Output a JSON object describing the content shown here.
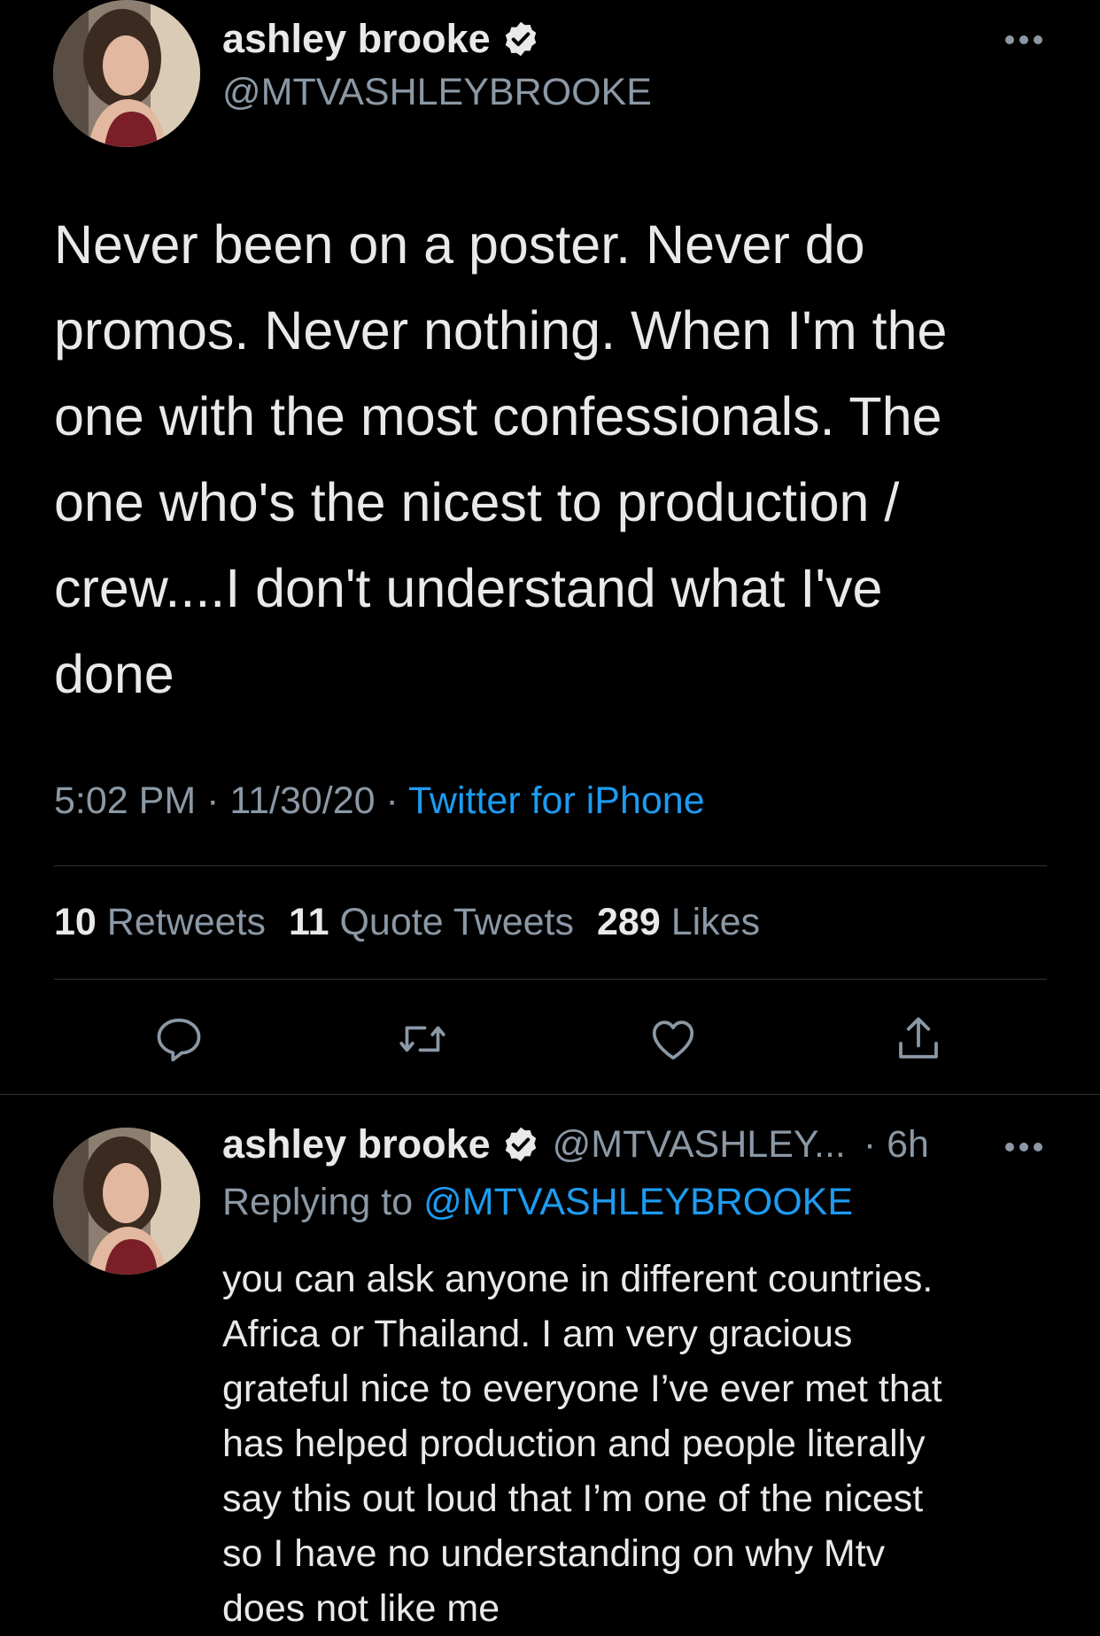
{
  "colors": {
    "background": "#000000",
    "text_primary": "#e7e9ea",
    "text_secondary": "#8b98a5",
    "accent": "#1d9bf0",
    "divider": "#2f3336"
  },
  "main_tweet": {
    "display_name": "ashley brooke",
    "verified_icon": "verified-badge-icon",
    "handle": "@MTVASHLEYBROOKE",
    "more_icon": "more-options-icon",
    "text_lines": [
      "Never been on a poster.  Never do",
      "promos. Never nothing. When I'm the",
      "one with the most confessionals. The",
      "one who's the nicest to production /",
      "crew....I don't understand what I've",
      "done"
    ],
    "time": "5:02 PM",
    "separator": "·",
    "date": "11/30/20",
    "source": "Twitter for iPhone",
    "stats": {
      "retweets_count": "10",
      "retweets_label": "Retweets",
      "quotes_count": "11",
      "quotes_label": "Quote Tweets",
      "likes_count": "289",
      "likes_label": "Likes"
    },
    "actions": [
      "reply-icon",
      "retweet-icon",
      "like-icon",
      "share-icon"
    ]
  },
  "reply_tweet": {
    "display_name": "ashley brooke",
    "verified_icon": "verified-badge-icon",
    "handle": "@MTVASHLEY...",
    "time": "· 6h",
    "more_icon": "more-options-icon",
    "replying_prefix": "Replying to",
    "replying_handle": "@MTVASHLEYBROOKE",
    "text_lines": [
      "you can alsk anyone in different countries.",
      "Africa or Thailand. I am very gracious",
      "grateful nice to everyone I’ve ever met that",
      "has helped production and people literally",
      "say this out loud that I’m one of the nicest",
      "so I have no understanding on why Mtv",
      "does not like me"
    ]
  }
}
